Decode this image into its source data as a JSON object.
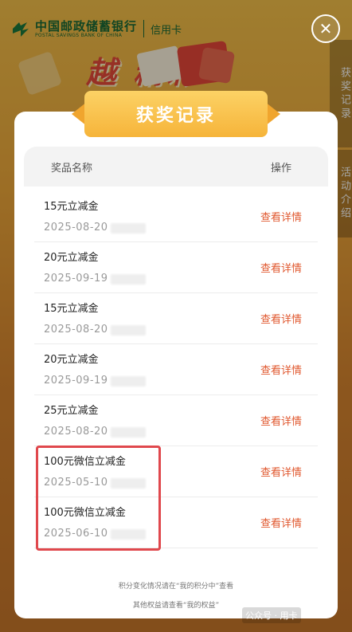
{
  "bank": {
    "name": "中国邮政储蓄银行",
    "name_en": "POSTAL SAVINGS BANK OF CHINA",
    "credit_card": "信用卡"
  },
  "banner": "越    精彩",
  "side_tabs": [
    "获奖记录",
    "活动介绍"
  ],
  "modal": {
    "title": "获奖记录",
    "col_name": "奖品名称",
    "col_action": "操作",
    "rows": [
      {
        "name": "15元立减金",
        "date": "2025-08-20",
        "action": "查看详情"
      },
      {
        "name": "20元立减金",
        "date": "2025-09-19",
        "action": "查看详情"
      },
      {
        "name": "15元立减金",
        "date": "2025-08-20",
        "action": "查看详情"
      },
      {
        "name": "20元立减金",
        "date": "2025-09-19",
        "action": "查看详情"
      },
      {
        "name": "25元立减金",
        "date": "2025-08-20",
        "action": "查看详情"
      },
      {
        "name": "100元微信立减金",
        "date": "2025-05-10",
        "action": "查看详情"
      },
      {
        "name": "100元微信立减金",
        "date": "2025-06-10",
        "action": "查看详情"
      }
    ],
    "note1": "积分变化情况请在“我的积分中”查看",
    "note2": "其他权益请查看“我的权益”"
  },
  "watermark": "公众号 · 用卡"
}
